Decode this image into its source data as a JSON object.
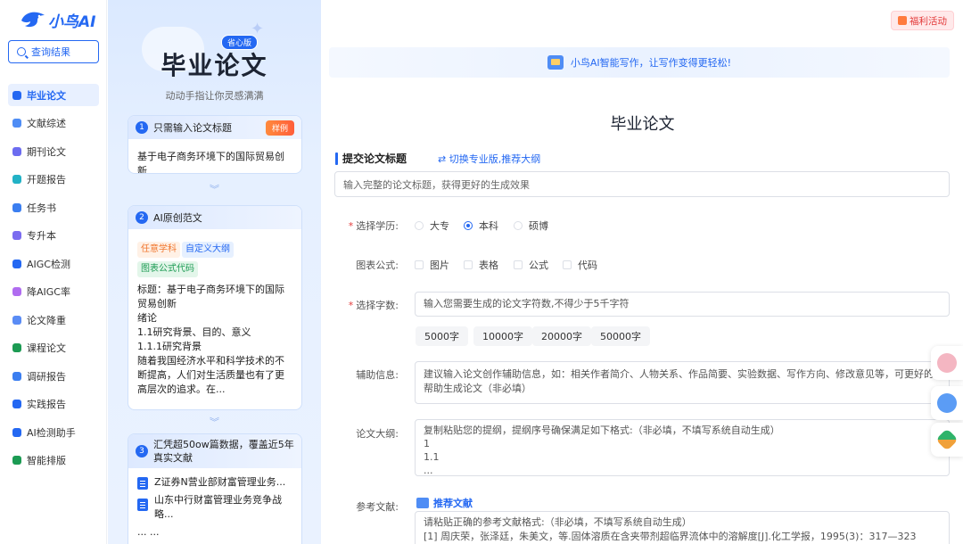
{
  "app": {
    "logo_text": "小鸟AI"
  },
  "nav": {
    "query_label": "查询结果",
    "items": [
      {
        "label": "毕业论文",
        "active": true,
        "color": "#2468f2"
      },
      {
        "label": "文献综述",
        "color": "#4f8df5"
      },
      {
        "label": "期刊论文",
        "color": "#6c6cf0"
      },
      {
        "label": "开题报告",
        "color": "#22b2c6"
      },
      {
        "label": "任务书",
        "color": "#3b7ef0"
      },
      {
        "label": "专升本",
        "color": "#7b6cf0"
      },
      {
        "label": "AIGC检测",
        "color": "#2468f2"
      },
      {
        "label": "降AIGC率",
        "color": "#b06cf0"
      },
      {
        "label": "论文降重",
        "color": "#5a8cf5"
      },
      {
        "label": "课程论文",
        "color": "#1c9b53"
      },
      {
        "label": "调研报告",
        "color": "#3b7ef0"
      },
      {
        "label": "实践报告",
        "color": "#2468f2"
      },
      {
        "label": "AI检测助手",
        "color": "#2468f2"
      },
      {
        "label": "智能排版",
        "color": "#1c9b53"
      }
    ]
  },
  "mid": {
    "title": "毕业论文",
    "badge": "省心版",
    "subtitle": "动动手指让你灵感满满",
    "card1": {
      "num": "1",
      "title": "只需输入论文标题",
      "badge": "样例",
      "body": "基于电子商务环境下的国际贸易创新"
    },
    "card2": {
      "num": "2",
      "title": "AI原创范文",
      "tags": [
        "任意学科",
        "自定义大纲",
        "图表公式代码"
      ],
      "lines": [
        "标题：基于电子商务环境下的国际贸易创新",
        "绪论",
        "1.1研究背景、目的、意义",
        "1.1.1研究背景",
        "随着我国经济水平和科学技术的不断提高，人们对生活质量也有了更高层次的追求。在..."
      ]
    },
    "card3": {
      "num": "3",
      "title": "汇凭超50ow篇数据，覆盖近5年真实文献",
      "refs": [
        "Z证券N营业部财富管理业务...",
        "山东中行财富管理业务竞争战略..."
      ],
      "more": "... ..."
    }
  },
  "main": {
    "welfare": "福利活动",
    "banner": "小鸟AI智能写作，让写作变得更轻松!",
    "page_title": "毕业论文",
    "section_title": "提交论文标题",
    "switch_link": "⇄ 切换专业版,推荐大纲",
    "title_placeholder": "输入完整的论文标题，获得更好的生成效果",
    "education": {
      "label": "选择学历:",
      "options": [
        "大专",
        "本科",
        "硕博"
      ],
      "selected": "本科"
    },
    "charts": {
      "label": "图表公式:",
      "options": [
        "图片",
        "表格",
        "公式",
        "代码"
      ]
    },
    "words": {
      "label": "选择字数:",
      "placeholder": "输入您需要生成的论文字符数,不得少于5千字符",
      "chips": [
        "5000字",
        "10000字",
        "20000字",
        "50000字"
      ]
    },
    "aux": {
      "label": "辅助信息:",
      "placeholder": "建议输入论文创作辅助信息，如：相关作者简介、人物关系、作品简要、实验数据、写作方向、修改意见等，可更好的帮助生成论文（非必填）"
    },
    "outline": {
      "label": "论文大纲:",
      "lines": [
        "复制粘贴您的提纲，提纲序号确保满足如下格式:（非必填，不填写系统自动生成）",
        "1",
        "1.1",
        "..."
      ]
    },
    "refs": {
      "label": "参考文献:",
      "recommend": "推荐文献",
      "lines": [
        "请粘贴正确的参考文献格式:（非必填，不填写系统自动生成）",
        "[1] 周庆荣，张泽廷，朱美文，等.固体溶质在含夹带剂超临界流体中的溶解度[J].化工学报，1995(3)：317—323"
      ]
    }
  }
}
